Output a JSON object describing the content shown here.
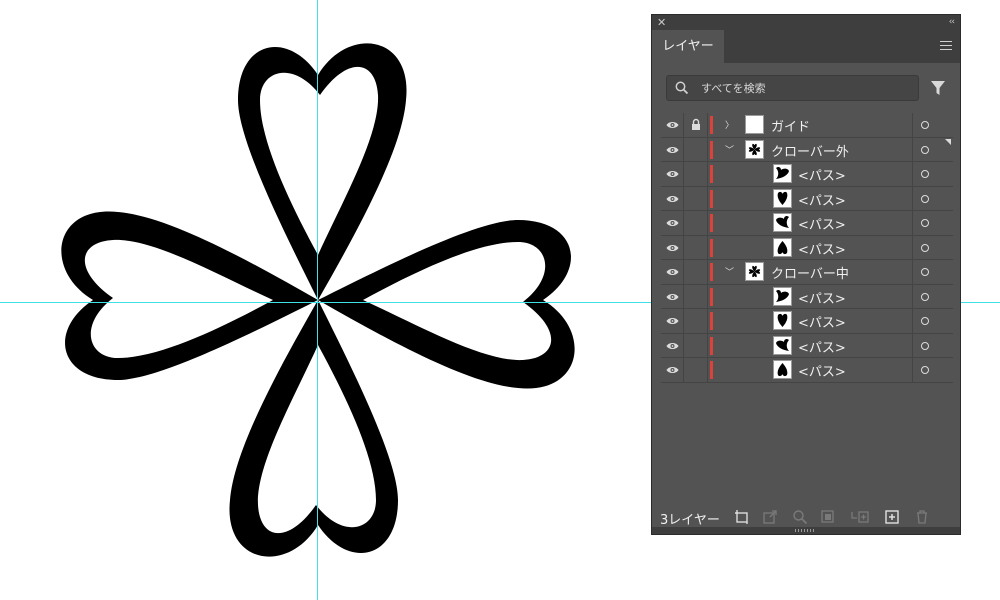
{
  "panel": {
    "tab_label": "レイヤー",
    "search_placeholder": "すべてを検索",
    "layer_count": "3レイヤー"
  },
  "layers": [
    {
      "name": "ガイド",
      "level": 0,
      "expanded": false,
      "locked": true,
      "visible": true
    },
    {
      "name": "クローバー外",
      "level": 0,
      "expanded": true,
      "locked": false,
      "visible": true
    },
    {
      "name": "<パス>",
      "level": 1,
      "locked": false,
      "visible": true
    },
    {
      "name": "<パス>",
      "level": 1,
      "locked": false,
      "visible": true
    },
    {
      "name": "<パス>",
      "level": 1,
      "locked": false,
      "visible": true
    },
    {
      "name": "<パス>",
      "level": 1,
      "locked": false,
      "visible": true
    },
    {
      "name": "クローバー中",
      "level": 0,
      "expanded": true,
      "locked": false,
      "visible": true
    },
    {
      "name": "<パス>",
      "level": 1,
      "locked": false,
      "visible": true
    },
    {
      "name": "<パス>",
      "level": 1,
      "locked": false,
      "visible": true
    },
    {
      "name": "<パス>",
      "level": 1,
      "locked": false,
      "visible": true
    },
    {
      "name": "<パス>",
      "level": 1,
      "locked": false,
      "visible": true
    }
  ],
  "icons": {
    "eye": "eye-icon",
    "lock": "lock-icon",
    "search": "search-icon",
    "filter": "filter-icon",
    "menu": "panel-menu-icon",
    "footer": [
      "collect-for-export-icon",
      "export-icon",
      "locate-object-icon",
      "clipping-mask-icon",
      "new-sublayer-icon",
      "new-layer-icon",
      "delete-icon"
    ]
  },
  "colors": {
    "panel_bg": "#535353",
    "layer_color": "#d9433c",
    "guide_color": "#3fe0e6",
    "artwork": "#000000"
  }
}
